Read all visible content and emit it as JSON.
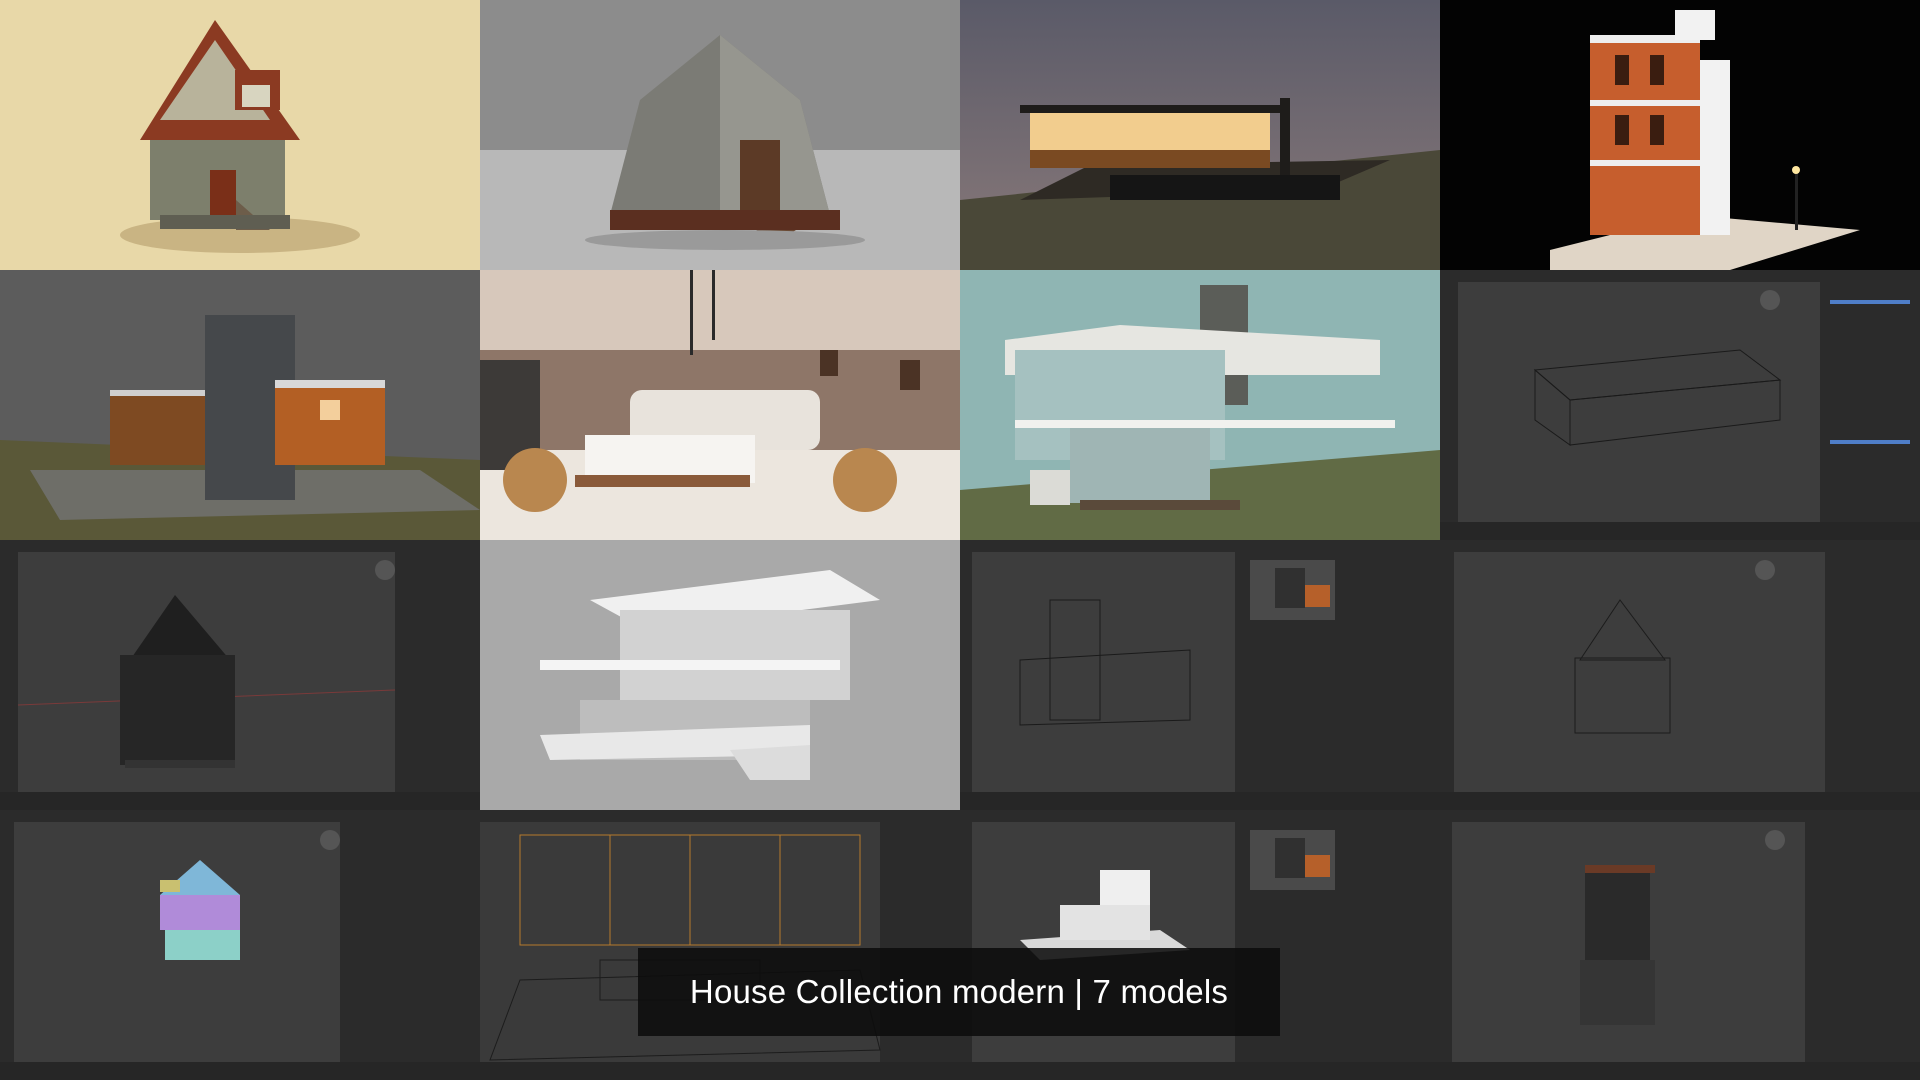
{
  "caption": {
    "text": "House Collection modern | 7 models"
  },
  "tiles": [
    {
      "kind": "render",
      "subject": "cottage-tall"
    },
    {
      "kind": "render",
      "subject": "cottage-stone"
    },
    {
      "kind": "render",
      "subject": "modern-house-lit"
    },
    {
      "kind": "render",
      "subject": "townhouse-night"
    },
    {
      "kind": "render",
      "subject": "modern-house-tower"
    },
    {
      "kind": "render",
      "subject": "living-room-interior"
    },
    {
      "kind": "render",
      "subject": "modern-house-balcony"
    },
    {
      "kind": "viewport",
      "subject": "wireframe-modern-house"
    },
    {
      "kind": "viewport",
      "subject": "cottage-dark-model"
    },
    {
      "kind": "render",
      "subject": "white-clay-house"
    },
    {
      "kind": "viewport",
      "subject": "wireframe-tower-house"
    },
    {
      "kind": "viewport",
      "subject": "wireframe-cottage"
    },
    {
      "kind": "viewport",
      "subject": "cottage-uv-colored"
    },
    {
      "kind": "viewport",
      "subject": "wireframe-interior"
    },
    {
      "kind": "viewport",
      "subject": "white-house-viewport"
    },
    {
      "kind": "viewport",
      "subject": "townhouse-viewport"
    }
  ],
  "colors": {
    "viewport_bg": "#3d3d3d",
    "panel_bg": "#2b2b2b",
    "timeline_bg": "#262626",
    "accent_blue": "#4f7ec8"
  }
}
